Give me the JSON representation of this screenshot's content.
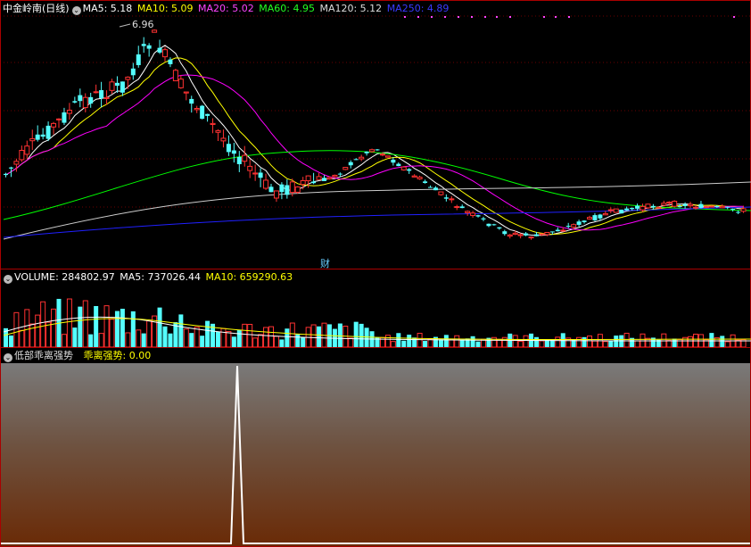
{
  "colors": {
    "up": "#ff3232",
    "down": "#54ffff",
    "ma5": "#ffffff",
    "ma10": "#ffff00",
    "ma20": "#ff00ff",
    "ma60": "#00ff00",
    "ma120": "#cccccc",
    "ma250": "#2020ff",
    "border": "#aa0000"
  },
  "main": {
    "title": "中金岭南(日线)",
    "ma5_label": "MA5: 5.18",
    "ma10_label": "MA10: 5.09",
    "ma20_label": "MA20: 5.02",
    "ma60_label": "MA60: 4.95",
    "ma120_label": "MA120: 5.12",
    "ma250_label": "MA250: 4.89",
    "high_marker": "6.96",
    "event_marker": "财"
  },
  "volume": {
    "title": "VOLUME: 284802.97",
    "ma5_label": "MA5: 737026.44",
    "ma10_label": "MA10: 659290.63"
  },
  "indicator": {
    "title": "低部乖离强势",
    "value_label": "乖离强势: 0.00"
  },
  "icons": {
    "collapse": "chevron-down-icon"
  }
}
